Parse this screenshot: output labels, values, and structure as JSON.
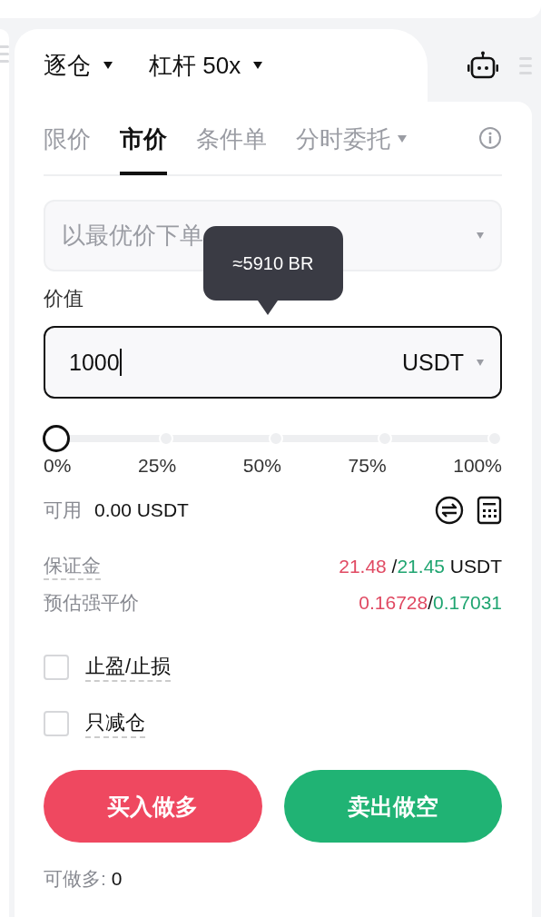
{
  "header": {
    "margin_mode": "逐仓",
    "leverage": "杠杆 50x"
  },
  "order_tabs": [
    {
      "label": "限价",
      "selected": false,
      "dropdown": false
    },
    {
      "label": "市价",
      "selected": true,
      "dropdown": false
    },
    {
      "label": "条件单",
      "selected": false,
      "dropdown": false
    },
    {
      "label": "分时委托",
      "selected": false,
      "dropdown": true
    }
  ],
  "price_select": {
    "placeholder": "以最优价下单"
  },
  "tooltip": "≈5910 BR",
  "value_field": {
    "label": "价值",
    "value": "1000",
    "unit": "USDT"
  },
  "slider": {
    "level": 0,
    "marks": [
      "0%",
      "25%",
      "50%",
      "75%",
      "100%"
    ]
  },
  "available": {
    "label": "可用",
    "value": "0.00 USDT"
  },
  "margin": {
    "label": "保证金",
    "long": "21.48 ",
    "sep": "/",
    "short": "21.45",
    "unit": " USDT"
  },
  "liquidation": {
    "label": "预估强平价",
    "long": "0.16728",
    "sep": "/",
    "short": "0.17031"
  },
  "options": [
    {
      "label": "止盈/止损",
      "checked": false
    },
    {
      "label": "只减仓",
      "checked": false
    }
  ],
  "buttons": [
    {
      "label": "买入做多",
      "kind": "buy"
    },
    {
      "label": "卖出做空",
      "kind": "sell"
    }
  ],
  "max_long": {
    "label": "可做多:",
    "value": "0"
  }
}
